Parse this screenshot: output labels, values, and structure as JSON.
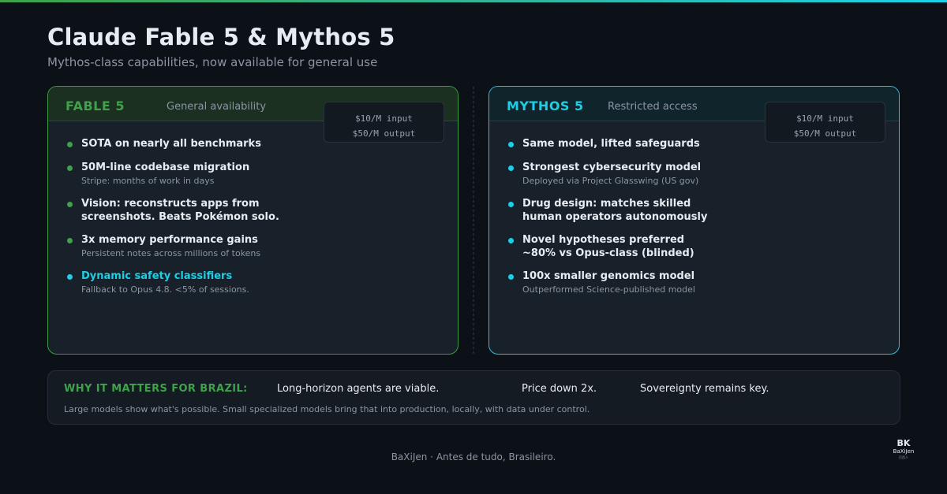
{
  "header": {
    "title": "Claude Fable 5 & Mythos 5",
    "subtitle": "Mythos-class capabilities, now available for general use"
  },
  "fable": {
    "name": "FABLE 5",
    "status": "General availability",
    "price_input": "$10/M input",
    "price_output": "$50/M output",
    "items": [
      {
        "title": "SOTA on nearly all benchmarks",
        "sub": ""
      },
      {
        "title": "50M-line codebase migration",
        "sub": "Stripe: months of work in days"
      },
      {
        "title_line1": "Vision: reconstructs apps from",
        "title_line2": "screenshots. Beats Pokémon solo.",
        "sub": ""
      },
      {
        "title": "3x memory performance gains",
        "sub": "Persistent notes across millions of tokens"
      },
      {
        "title": "Dynamic safety classifiers",
        "sub": "Fallback to Opus 4.8. <5% of sessions."
      }
    ]
  },
  "mythos": {
    "name": "MYTHOS 5",
    "status": "Restricted access",
    "price_input": "$10/M input",
    "price_output": "$50/M output",
    "items": [
      {
        "title": "Same model, lifted safeguards",
        "sub": ""
      },
      {
        "title": "Strongest cybersecurity model",
        "sub": "Deployed via Project Glasswing (US gov)"
      },
      {
        "title_line1": "Drug design: matches skilled",
        "title_line2": "human operators autonomously",
        "sub": ""
      },
      {
        "title_line1": "Novel hypotheses preferred",
        "title_line2": "~80% vs Opus-class (blinded)",
        "sub": ""
      },
      {
        "title": "100x smaller genomics model",
        "sub": "Outperformed Science-published model"
      }
    ]
  },
  "why": {
    "label": "WHY IT MATTERS FOR BRAZIL:",
    "points": [
      "Long-horizon agents are viable.",
      "Price down 2x.",
      "Sovereignty remains key."
    ],
    "description": "Large models show what's possible. Small specialized models bring that into production, locally, with data under control."
  },
  "footer": {
    "text": "BaXiJen · Antes de tudo, Brasileiro."
  },
  "logo": {
    "mark": "BK",
    "name": "BaXiJen",
    "small": "巴西人"
  },
  "colors": {
    "fable_accent": "#3fa24a",
    "mythos_accent": "#1ccfe6",
    "background": "#0c1118"
  }
}
